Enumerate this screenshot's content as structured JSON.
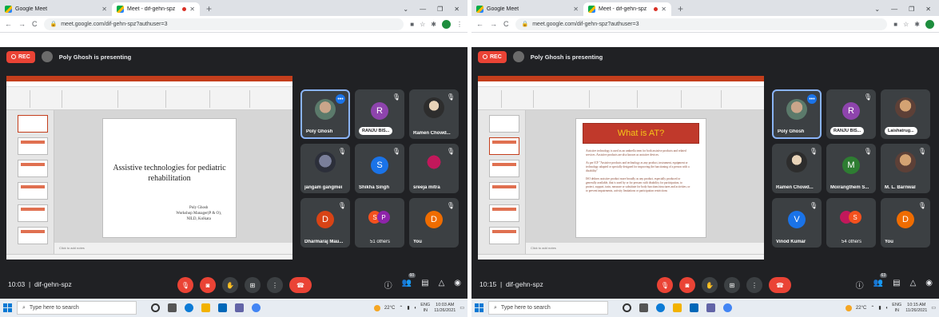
{
  "left": {
    "tab_inactive": "Google Meet",
    "tab_active": "Meet - dif-gehn-spz",
    "url": "meet.google.com/dif-gehn-spz?authuser=3",
    "rec_label": "REC",
    "presenting": "Poly Ghosh is presenting",
    "slide_title": "Assistive technologies for pediatric rehabilitation",
    "slide_author": "Poly Ghosh",
    "slide_role": "Workshop Manager(P & O),",
    "slide_org": "NILD, Kolkata",
    "notes_placeholder": "Click to add notes",
    "tiles": [
      {
        "name": "Poly Ghosh"
      },
      {
        "name": "RANJU BIS...",
        "initial": "R"
      },
      {
        "name": "Ramen Chowd..."
      },
      {
        "name": "jangam gangmei"
      },
      {
        "name": "Shikha Singh",
        "initial": "S"
      },
      {
        "name": "sreeja mitra"
      },
      {
        "name": "Dharmaraj Mau...",
        "initial": "D"
      },
      {
        "name": "51 others",
        "initial_a": "S",
        "initial_b": "P"
      },
      {
        "name": "You",
        "initial": "D"
      }
    ],
    "time": "10:03",
    "meeting_code": "dif-gehn-spz",
    "participants_count": "60",
    "clock_time": "10:03 AM",
    "clock_date": "11/26/2021"
  },
  "right": {
    "tab_inactive": "Google Meet",
    "tab_active": "Meet - dif-gehn-spz",
    "url": "meet.google.com/dif-gehn-spz?authuser=3",
    "rec_label": "REC",
    "presenting": "Poly Ghosh is presenting",
    "slide_heading": "What is AT?",
    "slide_p1": "Assistive technology is used as an umbrella term for both assistive products and related services. Assistive products are also known as assistive devices.",
    "slide_p2": "As per ICF \"Assistive products and technology as any product, instrument, equipment or technology adapted or specially designed for improving the functioning of a person with a disability\"",
    "slide_p3": "ISO defines assistive product more broadly as any product, especially produced or generally available, that is used by or for persons with disability for participation, to protect, support, train, measure or substitute for body functions/structures and activities; or to prevent impairments, activity limitations or participation restrictions",
    "notes_placeholder": "Click to add notes",
    "tiles": [
      {
        "name": "Poly Ghosh"
      },
      {
        "name": "RANJU BIS...",
        "initial": "R"
      },
      {
        "name": "Laishatrug..."
      },
      {
        "name": "Ramen Chowd..."
      },
      {
        "name": "Moirangthem S...",
        "initial": "M"
      },
      {
        "name": "M. L. Barnwal"
      },
      {
        "name": "Vinod Kumar",
        "initial": "V"
      },
      {
        "name": "54 others",
        "initial_b": "S"
      },
      {
        "name": "You",
        "initial": "D"
      }
    ],
    "time": "10:15",
    "meeting_code": "dif-gehn-spz",
    "participants_count": "63",
    "clock_time": "10:15 AM",
    "clock_date": "11/26/2021"
  },
  "taskbar": {
    "search_placeholder": "Type here to search",
    "weather": "22°C",
    "lang": "ENG",
    "region": "IN"
  },
  "colors": {
    "meet_bg": "#202124",
    "tile_bg": "#3c4043",
    "red": "#ea4335",
    "active_border": "#8ab4f8",
    "slide_header": "#c0392b",
    "slide_header_text": "#f5c518"
  }
}
